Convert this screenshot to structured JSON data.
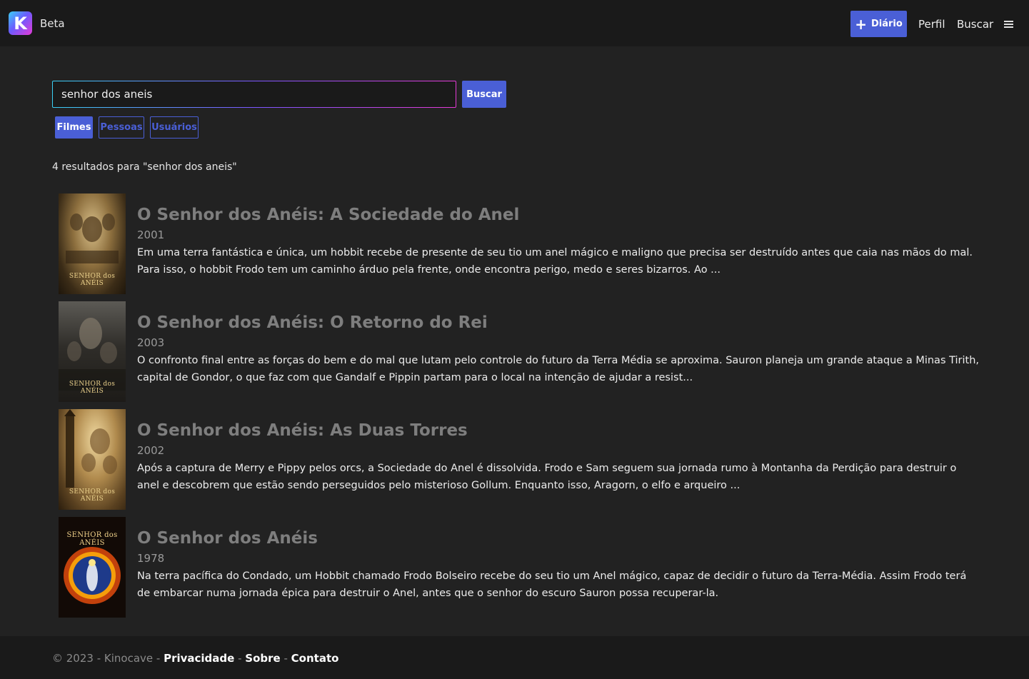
{
  "header": {
    "logo_letter": "K",
    "brand": "Beta",
    "diario_label": "Diário",
    "nav": [
      "Perfil",
      "Buscar"
    ]
  },
  "search": {
    "value": "senhor dos aneis",
    "button": "Buscar",
    "tabs": [
      "Filmes",
      "Pessoas",
      "Usuários"
    ],
    "active_tab": "Filmes"
  },
  "results_summary": "4 resultados para \"senhor dos aneis\"",
  "results": [
    {
      "poster_label": "SENHOR dos ANÉIS",
      "title": "O Senhor dos Anéis: A Sociedade do Anel",
      "year": "2001",
      "description": "Em uma terra fantástica e única, um hobbit recebe de presente de seu tio um anel mágico e maligno que precisa ser destruído antes que caia nas mãos do mal. Para isso, o hobbit Frodo tem um caminho árduo pela frente, onde encontra perigo, medo e seres bizarros. Ao ..."
    },
    {
      "poster_label": "SENHOR dos ANÉIS",
      "title": "O Senhor dos Anéis: O Retorno do Rei",
      "year": "2003",
      "description": "O confronto final entre as forças do bem e do mal que lutam pelo controle do futuro da Terra Média se aproxima. Sauron planeja um grande ataque a Minas Tirith, capital de Gondor, o que faz com que Gandalf e Pippin partam para o local na intenção de ajudar a resist..."
    },
    {
      "poster_label": "SENHOR dos ANÉIS",
      "title": "O Senhor dos Anéis: As Duas Torres",
      "year": "2002",
      "description": "Após a captura de Merry e Pippy pelos orcs, a Sociedade do Anel é dissolvida. Frodo e Sam seguem sua jornada rumo à Montanha da Perdição para destruir o anel e descobrem que estão sendo perseguidos pelo misterioso Gollum. Enquanto isso, Aragorn, o elfo e arqueiro ..."
    },
    {
      "poster_label": "SENHOR dos ANÉIS",
      "title": "O Senhor dos Anéis",
      "year": "1978",
      "description": "Na terra pacífica do Condado, um Hobbit chamado Frodo Bolseiro recebe do seu tio um Anel mágico, capaz de decidir o futuro da Terra-Média. Assim Frodo terá de embarcar numa jornada épica para destruir o Anel, antes que o senhor do escuro Sauron possa recuperar-la."
    }
  ],
  "footer": {
    "copyright": "© 2023 - Kinocave - ",
    "links": [
      "Privacidade",
      "Sobre",
      "Contato"
    ],
    "separator": " - "
  },
  "colors": {
    "accent": "#4a5fd6",
    "background": "#222222",
    "header": "#1a1a1a"
  }
}
